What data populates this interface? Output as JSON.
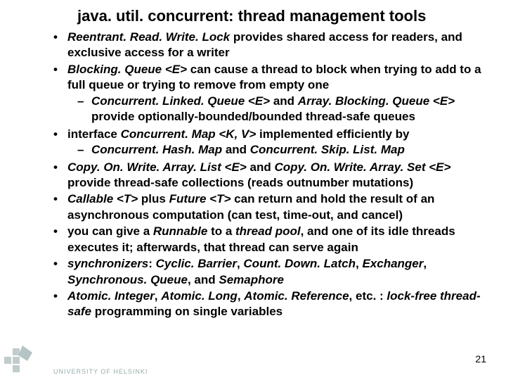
{
  "title": "java. util. concurrent:  thread management tools",
  "bullets": [
    {
      "pre": "",
      "em1": "Reentrant. Read. Write. Lock",
      "mid": " provides shared access for readers, and exclusive access for a writer"
    },
    {
      "pre": "",
      "em1": "Blocking. Queue <E>",
      "mid": " can cause a thread to block when trying to add to a full queue or trying to remove from empty one",
      "sub": [
        {
          "em1": "Concurrent. Linked. Queue <E>",
          "mid": " and ",
          "em2": "Array. Blocking. Queue <E>",
          "tail": " provide optionally-bounded/bounded thread-safe queues"
        }
      ]
    },
    {
      "pre": "interface ",
      "em1": "Concurrent. Map <K, V>",
      "mid": " implemented efficiently by",
      "sub": [
        {
          "em1": "Concurrent. Hash. Map",
          "mid": " and ",
          "em2": "Concurrent. Skip. List. Map",
          "tail": ""
        }
      ]
    },
    {
      "pre": "",
      "em1": "Copy. On. Write. Array. List <E>",
      "mid": " and ",
      "em2": "Copy. On. Write. Array. Set <E>",
      "tail": " provide thread-safe collections (reads outnumber mutations)"
    },
    {
      "pre": "",
      "em1": "Callable <T>",
      "mid": " plus ",
      "em2": "Future <T>",
      "tail": " can return and hold the result of an asynchronous computation (can test, time-out, and cancel)"
    },
    {
      "pre": "you can give a ",
      "em1": "Runnable",
      "mid": " to a ",
      "em2": "thread pool",
      "tail": ", and one of its idle threads executes it; afterwards, that thread can serve again"
    },
    {
      "pre": "",
      "em1": "synchronizers",
      "mid": ": ",
      "em2": "Cyclic. Barrier",
      "mid2": ", ",
      "em3": "Count. Down. Latch",
      "mid3": ", ",
      "em4": "Exchanger",
      "mid4": ", ",
      "em5": "Synchronous. Queue",
      "mid5": ", and ",
      "em6": "Semaphore"
    },
    {
      "pre": "",
      "em1": "Atomic. Integer",
      "mid": ", ",
      "em2": "Atomic. Long",
      "mid2": ", ",
      "em3": "Atomic. Reference",
      "mid3": ", etc. : ",
      "em4": "lock-free thread-safe",
      "tail": " programming on single variables"
    }
  ],
  "pagenum": "21",
  "uni": "UNIVERSITY OF HELSINKI"
}
